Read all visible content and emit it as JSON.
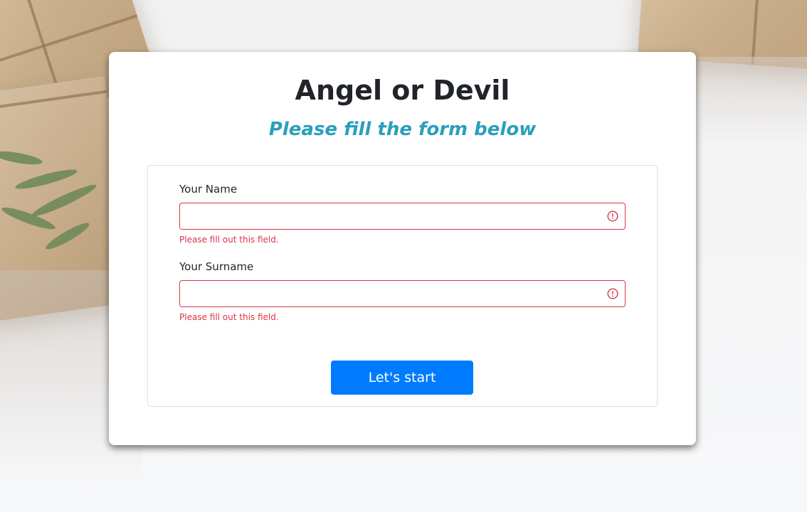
{
  "page": {
    "title": "Angel or Devil",
    "subtitle": "Please fill the form below"
  },
  "form": {
    "fields": [
      {
        "label": "Your Name",
        "value": "",
        "feedback": "Please fill out this field."
      },
      {
        "label": "Your Surname",
        "value": "",
        "feedback": "Please fill out this field."
      }
    ],
    "submit_label": "Let's start"
  },
  "colors": {
    "primary_button": "#007bff",
    "subtitle": "#2a9fbd",
    "invalid": "#dc3545",
    "heading": "#212529"
  },
  "icons": {
    "invalid": "exclamation-circle-icon",
    "background": "gift-boxes-photo"
  }
}
